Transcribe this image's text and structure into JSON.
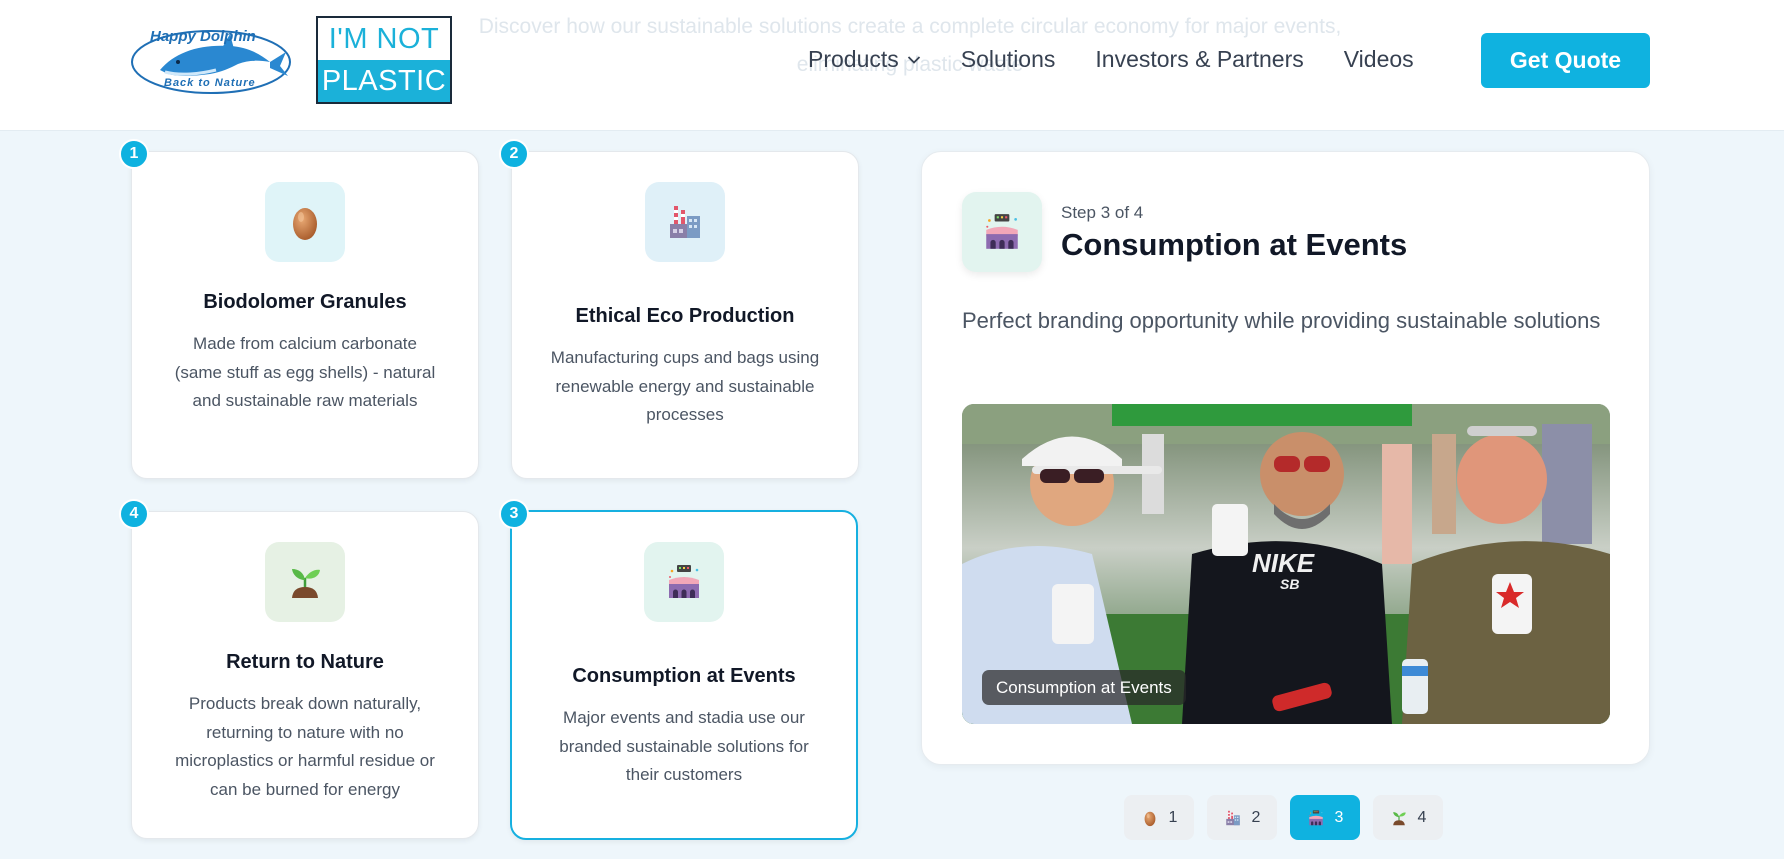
{
  "header": {
    "background_text": "Discover how our sustainable solutions create a complete circular economy for major events, eliminating plastic waste",
    "logo_dolphin": {
      "top": "Happy Dolphin",
      "bottom": "Back to Nature"
    },
    "logo_plastic": {
      "line1": "I'M NOT",
      "line2": "PLASTIC"
    },
    "nav": [
      "Products",
      "Solutions",
      "Investors & Partners",
      "Videos"
    ],
    "cta_label": "Get Quote"
  },
  "cards": [
    {
      "badge": "1",
      "title": "Biodolomer Granules",
      "description": "Made from calcium carbonate (same stuff as egg shells) - natural and sustainable raw materials",
      "icon": "egg-icon"
    },
    {
      "badge": "2",
      "title": "Ethical Eco Production",
      "description": "Manufacturing cups and bags using renewable energy and sustainable processes",
      "icon": "factory-icon"
    },
    {
      "badge": "4",
      "title": "Return to Nature",
      "description": "Products break down naturally, returning to nature with no microplastics or harmful residue or can be burned for energy",
      "icon": "sprout-icon"
    },
    {
      "badge": "3",
      "title": "Consumption at Events",
      "description": "Major events and stadia use our branded sustainable solutions for their customers",
      "icon": "stadium-icon"
    }
  ],
  "detail": {
    "step": "Step 3 of 4",
    "title": "Consumption at Events",
    "description": "Perfect branding opportunity while providing sustainable solutions",
    "photo_caption": "Consumption at Events",
    "photo_print": {
      "shirt_brand": "NIKE",
      "shirt_sub": "SB"
    }
  },
  "pager": [
    {
      "label": "1",
      "icon": "egg-icon"
    },
    {
      "label": "2",
      "icon": "factory-icon"
    },
    {
      "label": "3",
      "icon": "stadium-icon",
      "active": true
    },
    {
      "label": "4",
      "icon": "sprout-icon"
    }
  ],
  "colors": {
    "accent": "#0fb2e0",
    "text_dark": "#111827",
    "text_muted": "#4b5563",
    "page_bg": "#eef6fb"
  }
}
